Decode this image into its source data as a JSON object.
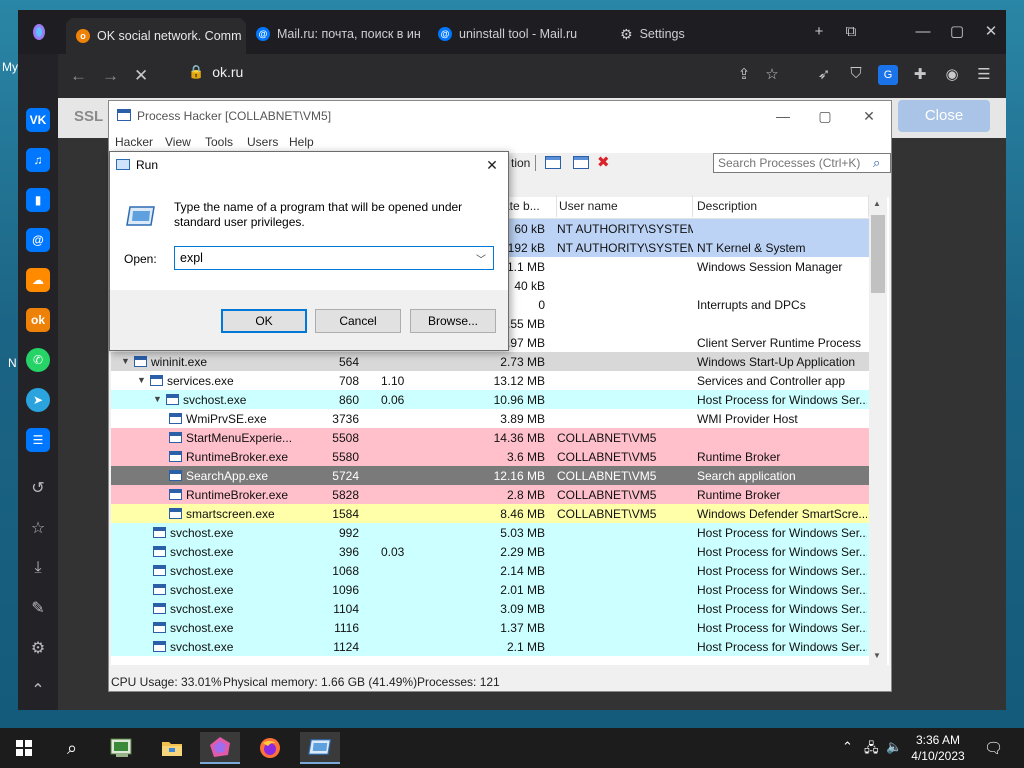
{
  "desktop": {
    "frag_my": "My",
    "frag_n": "N"
  },
  "browser": {
    "tabs": [
      {
        "label": "OK social network. Comm",
        "favicon": "ok-favicon",
        "color": "#ee8208"
      },
      {
        "label": "Mail.ru: почта, поиск в ин",
        "favicon": "mailru-at-icon",
        "color": "#0077ff"
      },
      {
        "label": "uninstall tool - Mail.ru",
        "favicon": "mailru-at-icon",
        "color": "#0077ff"
      },
      {
        "label": "Settings",
        "favicon": "gear-icon",
        "color": "#cfcfd2"
      }
    ],
    "url": "ok.ru",
    "sidebar_apps": [
      "vk",
      "music",
      "stats",
      "mail",
      "cloud",
      "ok",
      "whatsapp",
      "telegram",
      "list",
      "history",
      "favorites",
      "downloads",
      "extensions",
      "settings",
      "collapse"
    ]
  },
  "page": {
    "ssl_label": "SSL",
    "close_label": "Close"
  },
  "process_hacker": {
    "title": "Process Hacker [COLLABNET\\VM5]",
    "menu": [
      "Hacker",
      "View",
      "Tools",
      "Users",
      "Help"
    ],
    "toolbar_partial": "tion",
    "search_placeholder": "Search Processes (Ctrl+K)",
    "columns": {
      "mem": "ate b...",
      "user": "User name",
      "desc": "Description"
    },
    "rows": [
      {
        "name": "",
        "pid": "",
        "cpu": "",
        "mem": "60 kB",
        "user": "NT AUTHORITY\\SYSTEM",
        "desc": "",
        "bg": "#bcd3f5"
      },
      {
        "name": "",
        "pid": "",
        "cpu": "",
        "mem": "192 kB",
        "user": "NT AUTHORITY\\SYSTEM",
        "desc": "NT Kernel & System",
        "bg": "#bcd3f5"
      },
      {
        "name": "",
        "pid": "",
        "cpu": "",
        "mem": "1.1 MB",
        "user": "",
        "desc": "Windows Session Manager",
        "bg": "#ffffff"
      },
      {
        "name": "",
        "pid": "",
        "cpu": "",
        "mem": "40 kB",
        "user": "",
        "desc": "",
        "bg": "#ffffff"
      },
      {
        "name": "",
        "pid": "",
        "cpu": "",
        "mem": "0",
        "user": "",
        "desc": "Interrupts and DPCs",
        "bg": "#ffffff"
      },
      {
        "name": "",
        "pid": "",
        "cpu": "",
        "mem": ".55 MB",
        "user": "",
        "desc": "",
        "bg": "#ffffff"
      },
      {
        "name": "",
        "pid": "",
        "cpu": "",
        "mem": ".97 MB",
        "user": "",
        "desc": "Client Server Runtime Process",
        "bg": "#ffffff"
      },
      {
        "name": "wininit.exe",
        "pid": "564",
        "cpu": "",
        "mem": "2.73 MB",
        "user": "",
        "desc": "Windows Start-Up Application",
        "bg": "#d8d8d8",
        "indent": 0,
        "exp": "▼"
      },
      {
        "name": "services.exe",
        "pid": "708",
        "cpu": "1.10",
        "mem": "13.12 MB",
        "user": "",
        "desc": "Services and Controller app",
        "bg": "#ffffff",
        "indent": 1,
        "exp": "▼"
      },
      {
        "name": "svchost.exe",
        "pid": "860",
        "cpu": "0.06",
        "mem": "10.96 MB",
        "user": "",
        "desc": "Host Process for Windows Ser...",
        "bg": "#ccffff",
        "indent": 2,
        "exp": "▼"
      },
      {
        "name": "WmiPrvSE.exe",
        "pid": "3736",
        "cpu": "",
        "mem": "3.89 MB",
        "user": "",
        "desc": "WMI Provider Host",
        "bg": "#ffffff",
        "indent": 3
      },
      {
        "name": "StartMenuExperie...",
        "pid": "5508",
        "cpu": "",
        "mem": "14.36 MB",
        "user": "COLLABNET\\VM5",
        "desc": "",
        "bg": "#ffc0cb",
        "indent": 3
      },
      {
        "name": "RuntimeBroker.exe",
        "pid": "5580",
        "cpu": "",
        "mem": "3.6 MB",
        "user": "COLLABNET\\VM5",
        "desc": "Runtime Broker",
        "bg": "#ffc0cb",
        "indent": 3
      },
      {
        "name": "SearchApp.exe",
        "pid": "5724",
        "cpu": "",
        "mem": "12.16 MB",
        "user": "COLLABNET\\VM5",
        "desc": "Search application",
        "bg": "#7a7a7a",
        "fg": "#ffffff",
        "indent": 3
      },
      {
        "name": "RuntimeBroker.exe",
        "pid": "5828",
        "cpu": "",
        "mem": "2.8 MB",
        "user": "COLLABNET\\VM5",
        "desc": "Runtime Broker",
        "bg": "#ffc0cb",
        "indent": 3
      },
      {
        "name": "smartscreen.exe",
        "pid": "1584",
        "cpu": "",
        "mem": "8.46 MB",
        "user": "COLLABNET\\VM5",
        "desc": "Windows Defender SmartScre...",
        "bg": "#ffffaa",
        "indent": 3
      },
      {
        "name": "svchost.exe",
        "pid": "992",
        "cpu": "",
        "mem": "5.03 MB",
        "user": "",
        "desc": "Host Process for Windows Ser...",
        "bg": "#ccffff",
        "indent": 2
      },
      {
        "name": "svchost.exe",
        "pid": "396",
        "cpu": "0.03",
        "mem": "2.29 MB",
        "user": "",
        "desc": "Host Process for Windows Ser...",
        "bg": "#ccffff",
        "indent": 2
      },
      {
        "name": "svchost.exe",
        "pid": "1068",
        "cpu": "",
        "mem": "2.14 MB",
        "user": "",
        "desc": "Host Process for Windows Ser...",
        "bg": "#ccffff",
        "indent": 2
      },
      {
        "name": "svchost.exe",
        "pid": "1096",
        "cpu": "",
        "mem": "2.01 MB",
        "user": "",
        "desc": "Host Process for Windows Ser...",
        "bg": "#ccffff",
        "indent": 2
      },
      {
        "name": "svchost.exe",
        "pid": "1104",
        "cpu": "",
        "mem": "3.09 MB",
        "user": "",
        "desc": "Host Process for Windows Ser...",
        "bg": "#ccffff",
        "indent": 2
      },
      {
        "name": "svchost.exe",
        "pid": "1116",
        "cpu": "",
        "mem": "1.37 MB",
        "user": "",
        "desc": "Host Process for Windows Ser...",
        "bg": "#ccffff",
        "indent": 2
      },
      {
        "name": "svchost.exe",
        "pid": "1124",
        "cpu": "",
        "mem": "2.1 MB",
        "user": "",
        "desc": "Host Process for Windows Ser...",
        "bg": "#ccffff",
        "indent": 2
      }
    ],
    "status": {
      "cpu": "CPU Usage: 33.01%",
      "mem": "Physical memory: 1.66 GB (41.49%)",
      "procs": "Processes: 121"
    }
  },
  "run_dialog": {
    "title": "Run",
    "description": "Type the name of a program that will be opened under standard user privileges.",
    "open_label": "Open:",
    "input_value": "expl",
    "ok_label": "OK",
    "cancel_label": "Cancel",
    "browse_label": "Browse..."
  },
  "taskbar": {
    "time": "3:36 AM",
    "date": "4/10/2023",
    "apps": [
      "start",
      "search",
      "process-hacker",
      "file-explorer",
      "yandex-browser",
      "firefox",
      "run"
    ]
  }
}
